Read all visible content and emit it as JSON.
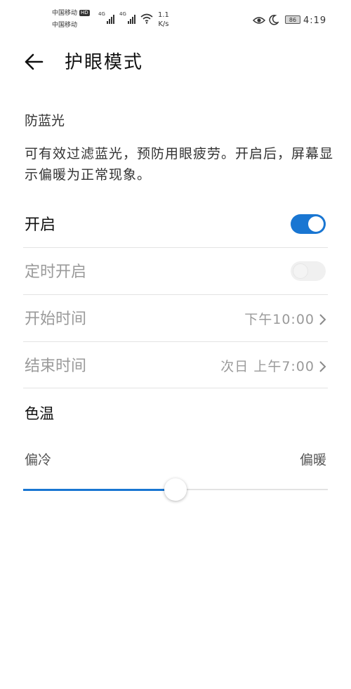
{
  "status_bar": {
    "carrier1": "中国移动",
    "carrier2": "中国移动",
    "hd_badge": "HD",
    "network1": "4G",
    "network2": "4G",
    "speed_value": "1.1",
    "speed_unit": "K/s",
    "battery": "86",
    "time": "4:19"
  },
  "header": {
    "title": "护眼模式"
  },
  "section": {
    "title": "防蓝光",
    "description": "可有效过滤蓝光，预防用眼疲劳。开启后，屏幕显示偏暖为正常现象。"
  },
  "settings": {
    "enable_label": "开启",
    "enable_on": true,
    "schedule_label": "定时开启",
    "schedule_on": false,
    "start_label": "开始时间",
    "start_value": "下午10:00",
    "end_label": "结束时间",
    "end_value": "次日 上午7:00"
  },
  "color_temp": {
    "label": "色温",
    "min_label": "偏冷",
    "max_label": "偏暖",
    "level": 0.5
  },
  "colors": {
    "accent": "#1976d2"
  }
}
